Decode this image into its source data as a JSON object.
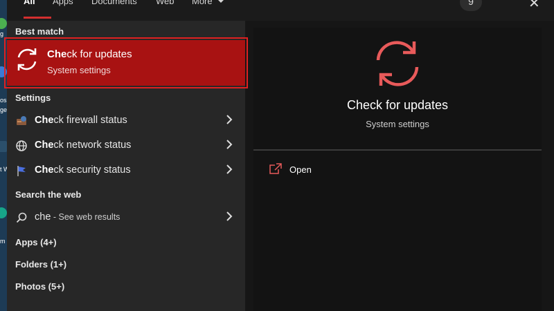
{
  "tabs": [
    {
      "label": "All",
      "active": true
    },
    {
      "label": "Apps"
    },
    {
      "label": "Documents"
    },
    {
      "label": "Web"
    },
    {
      "label": "More"
    }
  ],
  "topbar": {
    "badge": "9",
    "more_glyph": "···",
    "close_glyph": "✕"
  },
  "desktop": {
    "labels": [
      "g",
      "os",
      "ge",
      "t W",
      "m"
    ]
  },
  "left": {
    "best_match_heading": "Best match",
    "best_match": {
      "title_bold": "Che",
      "title_rest": "ck for updates",
      "subtitle": "System settings",
      "icon": "sync-icon"
    },
    "settings_heading": "Settings",
    "settings_items": [
      {
        "bold": "Che",
        "rest": "ck firewall status",
        "icon": "firewall-icon"
      },
      {
        "bold": "Che",
        "rest": "ck network status",
        "icon": "globe-icon"
      },
      {
        "bold": "Che",
        "rest": "ck security status",
        "icon": "flag-icon"
      }
    ],
    "web_heading": "Search the web",
    "web_item": {
      "query": "che",
      "suffix": " - See web results",
      "icon": "search-icon"
    },
    "groups": [
      "Apps (4+)",
      "Folders (1+)",
      "Photos (5+)"
    ]
  },
  "preview": {
    "title": "Check for updates",
    "subtitle": "System settings",
    "open_label": "Open",
    "icon": "sync-icon"
  },
  "colors": {
    "accent": "#e02020",
    "selected_bg": "#a81212",
    "icon_red": "#e85a5a"
  }
}
